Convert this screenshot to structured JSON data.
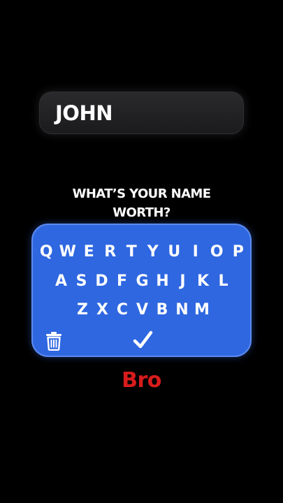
{
  "name_field": {
    "value": "JOHN"
  },
  "prompt": {
    "line1": "WHAT’S YOUR NAME",
    "line2": "WORTH?"
  },
  "keyboard": {
    "rows": [
      [
        "Q",
        "W",
        "E",
        "R",
        "T",
        "Y",
        "U",
        "I",
        "O",
        "P"
      ],
      [
        "A",
        "S",
        "D",
        "F",
        "G",
        "H",
        "J",
        "K",
        "L"
      ],
      [
        "Z",
        "X",
        "C",
        "V",
        "B",
        "N",
        "M"
      ]
    ],
    "delete_icon": "trash-icon",
    "confirm_icon": "checkmark-icon"
  },
  "result": {
    "text": "Bro"
  },
  "colors": {
    "background": "#000000",
    "keyboard": "#2f67e0",
    "result": "#d81c1c",
    "text": "#ffffff"
  }
}
